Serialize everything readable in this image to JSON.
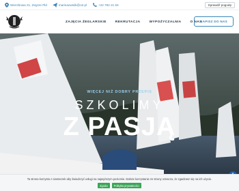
{
  "topbar": {
    "address": "Wierzbowa 21, Zegrze Płd",
    "email": "marinaowsiik@o2.pl",
    "phone": "+22 782 21 63",
    "weather_button": "Sprawdź pogodę"
  },
  "header": {
    "nav": [
      {
        "label": "ZAJĘCIA ŻEGLARSKIE"
      },
      {
        "label": "REKRUTACJA"
      },
      {
        "label": "WYPOŻYCZALNIA"
      },
      {
        "label": "O NAS"
      }
    ],
    "cta_label": "NAPISZ DO NAS"
  },
  "hero": {
    "kicker": "WIĘCEJ NIŻ DOBRY PRZEPIS",
    "title_line1": "SZKOLIMY",
    "title_line2": "Z PASJĄ"
  },
  "cookie_bar": {
    "message": "Ta strona korzysta z ciasteczek aby świadczyć usługi na najwyższym poziomie. Dalsze korzystanie ze strony oznacza, że zgadzasz się na ich użycie.",
    "accept_label": "Zgoda",
    "policy_label": "Polityka prywatności"
  },
  "colors": {
    "accent": "#3b86b8",
    "text_dark": "#22313f",
    "cookie_button": "#3aa657",
    "a11y_button": "#1c5fa8"
  },
  "icons": {
    "address": "location-pin-icon",
    "email": "paper-plane-icon",
    "phone": "phone-icon",
    "accessibility": "wheelchair-icon"
  }
}
